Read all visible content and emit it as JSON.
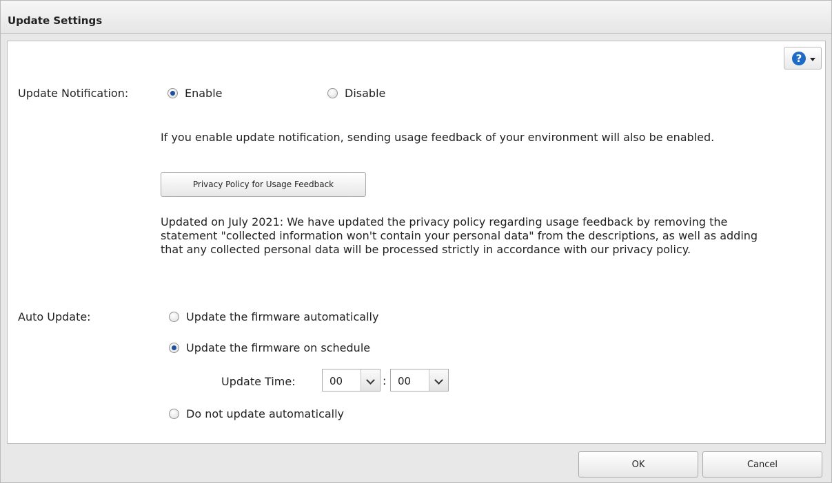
{
  "dialog": {
    "title": "Update Settings"
  },
  "help": {
    "icon": "question-circle-icon",
    "accent": "#1d6bc4"
  },
  "update_notification": {
    "label": "Update Notification:",
    "options": [
      {
        "label": "Enable",
        "selected": true
      },
      {
        "label": "Disable",
        "selected": false
      }
    ],
    "info_text": "If you enable update notification, sending usage feedback of your environment will also be enabled.",
    "privacy_button_label": "Privacy Policy for Usage Feedback",
    "policy_update_text": "Updated on July 2021: We have updated the privacy policy regarding usage feedback by removing the statement \"collected information won't contain your personal data\" from the descriptions, as well as adding that any collected personal data will be processed strictly in accordance with our privacy policy."
  },
  "auto_update": {
    "label": "Auto Update:",
    "options": [
      {
        "label": "Update the firmware automatically",
        "selected": false
      },
      {
        "label": "Update the firmware on schedule",
        "selected": true
      },
      {
        "label": "Do not update automatically",
        "selected": false
      }
    ],
    "update_time_label": "Update Time:",
    "hour": "00",
    "separator": ":",
    "minute": "00"
  },
  "footer": {
    "ok_label": "OK",
    "cancel_label": "Cancel"
  }
}
